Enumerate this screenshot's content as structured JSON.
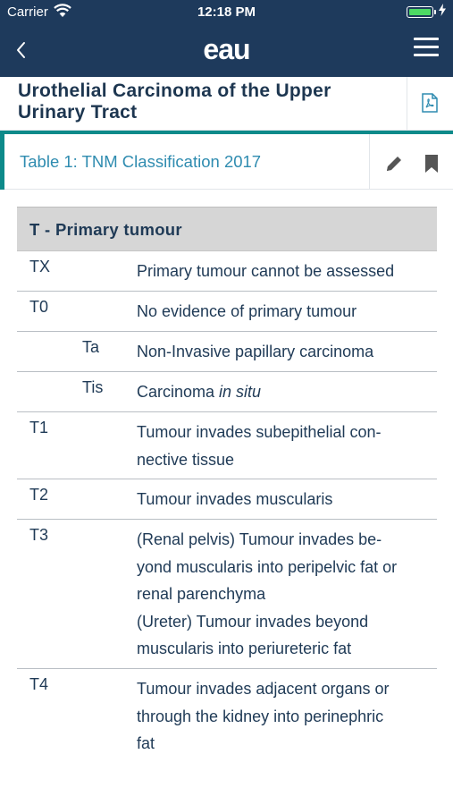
{
  "status_bar": {
    "carrier": "Carrier",
    "time": "12:18 PM"
  },
  "nav": {
    "logo": "eau",
    "back_icon": "chevron-left-icon",
    "menu_icon": "hamburger-menu-icon"
  },
  "document": {
    "title_line1": "Urothelial Carcinoma of the Upper",
    "title_line2": "Urinary Tract",
    "pdf_icon": "pdf-document-icon"
  },
  "section": {
    "title": "Table 1: TNM Classification 2017",
    "edit_icon": "pencil-icon",
    "bookmark_icon": "bookmark-icon"
  },
  "table": {
    "header": "T - Primary tumour",
    "rows": [
      {
        "code": "TX",
        "lines": [
          "Primary tumour cannot be assessed"
        ]
      },
      {
        "code": "T0",
        "lines": [
          "No evidence of primary tumour"
        ]
      },
      {
        "code": "Ta",
        "lines": [
          "Non-Invasive papillary carcinoma"
        ]
      },
      {
        "code": "Tis",
        "desc_main": "Carcinoma ",
        "desc_italic": "in situ"
      },
      {
        "code": "T1",
        "lines": [
          "Tumour invades subepithelial con-",
          "nective tissue"
        ]
      },
      {
        "code": "T2",
        "lines": [
          "Tumour invades muscularis"
        ]
      },
      {
        "code": "T3",
        "lines": [
          "(Renal pelvis) Tumour invades be-",
          "yond muscularis into peripelvic fat or",
          "renal parenchyma",
          "(Ureter) Tumour invades beyond",
          "muscularis into periureteric fat"
        ]
      },
      {
        "code": "T4",
        "lines": [
          "Tumour invades adjacent organs or",
          "through the kidney into perinephric",
          "fat"
        ]
      }
    ]
  },
  "colors": {
    "nav_bg": "#1e3a5c",
    "accent_teal": "#0d8a8a",
    "link_blue": "#2f8cb0",
    "battery_green": "#4cd964",
    "table_header_bg": "#d6d6d6"
  }
}
